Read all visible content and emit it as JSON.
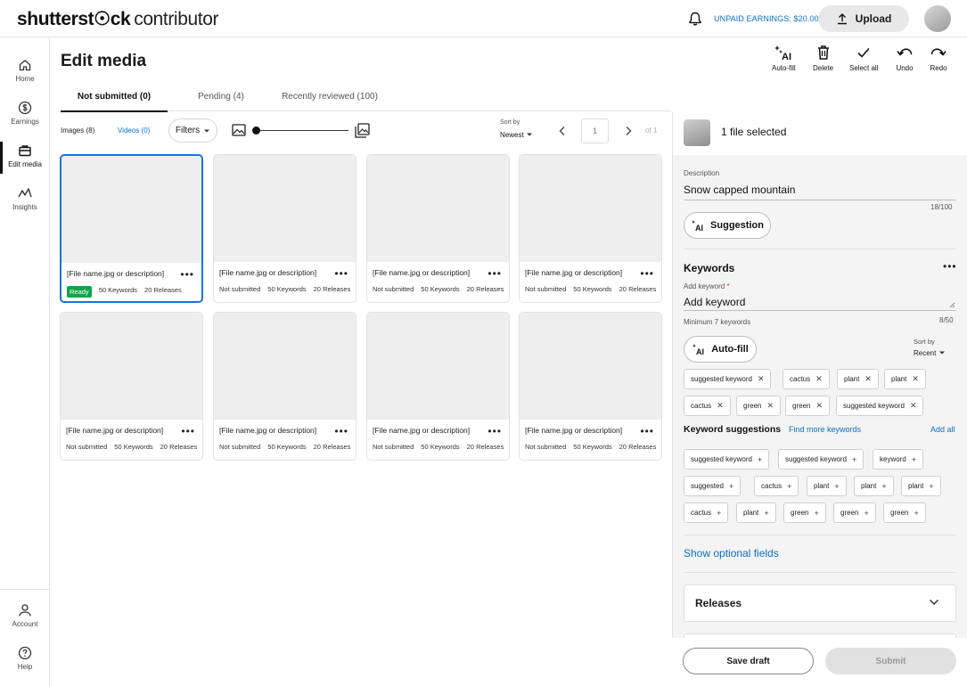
{
  "header": {
    "logo_main": "shutterst",
    "logo_glyph": "☉",
    "logo_end": "ck",
    "logo_sub": "contributor",
    "unpaid_earnings": "UNPAID EARNINGS: $20.00",
    "upload_label": "Upload"
  },
  "nav": {
    "items": [
      {
        "label": "Home"
      },
      {
        "label": "Earnings"
      },
      {
        "label": "Edit media"
      },
      {
        "label": "Insights"
      }
    ],
    "bottom": [
      {
        "label": "Account"
      },
      {
        "label": "Help"
      }
    ]
  },
  "main": {
    "title": "Edit media",
    "tabs": [
      {
        "label": "Not submitted (0)"
      },
      {
        "label": "Pending (4)"
      },
      {
        "label": "Recently reviewed (100)"
      }
    ],
    "actions": {
      "autofill": "Auto-fill",
      "delete": "Delete",
      "select_all": "Select all",
      "undo": "Undo",
      "redo": "Redo"
    },
    "filters": {
      "images": "Images (8)",
      "videos": "Videos (0)",
      "filters_label": "Filters",
      "sort_by_label": "Sort by",
      "sort_by_value": "Newest",
      "page": "1",
      "of": "of 1"
    },
    "cards": [
      {
        "fname": "[File name.jpg or description]",
        "status": "Ready",
        "keywords": "50 Keywords",
        "releases": "20 Releases"
      },
      {
        "fname": "[File name.jpg or description]",
        "status": "Not submitted",
        "keywords": "50 Keywords",
        "releases": "20 Releases"
      },
      {
        "fname": "[File name.jpg or description]",
        "status": "Not submitted",
        "keywords": "50 Keywords",
        "releases": "20 Releases"
      },
      {
        "fname": "[File name.jpg or description]",
        "status": "Not submitted",
        "keywords": "50 Keywords",
        "releases": "20 Releases"
      },
      {
        "fname": "[File name.jpg or description]",
        "status": "Not submitted",
        "keywords": "50 Keywords",
        "releases": "20 Releases"
      },
      {
        "fname": "[File name.jpg or description]",
        "status": "Not submitted",
        "keywords": "50 Keywords",
        "releases": "20 Releases"
      },
      {
        "fname": "[File name.jpg or description]",
        "status": "Not submitted",
        "keywords": "50 Keywords",
        "releases": "20 Releases"
      },
      {
        "fname": "[File name.jpg or description]",
        "status": "Not submitted",
        "keywords": "50 Keywords",
        "releases": "20 Releases"
      }
    ]
  },
  "panel": {
    "selected": "1 file selected",
    "description_label": "Description",
    "description_value": "Snow capped mountain",
    "description_count": "18/100",
    "suggestion": "Suggestion",
    "keywords_title": "Keywords",
    "add_keyword_label": "Add keyword",
    "add_keyword_value": "Add keyword",
    "min_keywords": "Minimum 7 keywords",
    "keyword_count": "8/50",
    "autofill": "Auto-fill",
    "sort_by_label": "Sort by",
    "sort_by_value": "Recent",
    "keywords": [
      "suggested keyword",
      "cactus",
      "plant",
      "plant",
      "cactus",
      "green",
      "green",
      "suggested keyword"
    ],
    "suggestions_title": "Keyword suggestions",
    "find_more": "Find more keywords",
    "add_all": "Add all",
    "suggestions": [
      "suggested keyword",
      "suggested keyword",
      "keyword",
      "suggested",
      "cactus",
      "plant",
      "plant",
      "plant",
      "cactus",
      "plant",
      "green",
      "green",
      "green"
    ],
    "show_optional": "Show optional fields",
    "releases": "Releases",
    "save_draft": "Save draft",
    "submit": "Submit"
  },
  "colors": {
    "accent_blue": "#0b6ec5",
    "selection_border": "#1a73d9",
    "ready_green": "#15a34a"
  }
}
